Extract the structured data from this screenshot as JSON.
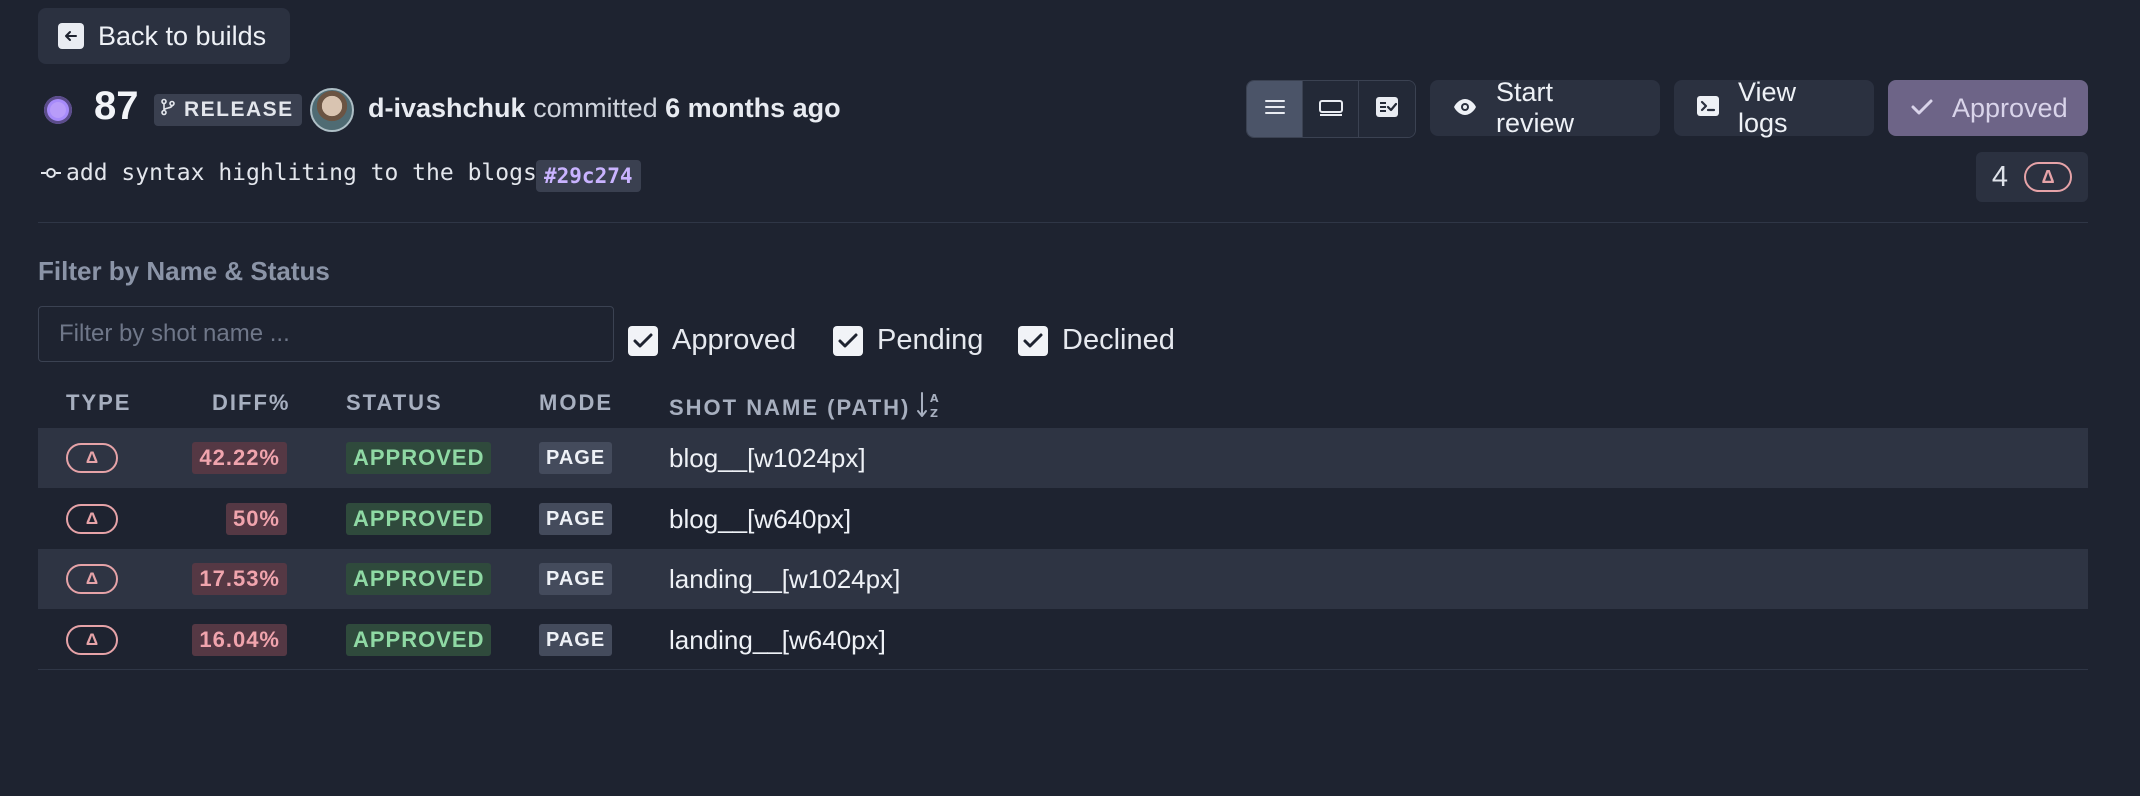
{
  "nav": {
    "back_label": "Back to builds"
  },
  "build": {
    "number": "87",
    "branch": "RELEASE",
    "author": "d-ivashchuk",
    "committed_text": "committed",
    "when": "6 months ago",
    "commit_message": "add syntax highliting to the blogs",
    "commit_hash": "#29c274",
    "changed_count": "4",
    "delta_symbol": "Δ",
    "status_color": "#a78bfa"
  },
  "toolbar": {
    "view_modes": [
      {
        "icon": "list-icon",
        "active": true
      },
      {
        "icon": "single-view-icon",
        "active": false
      },
      {
        "icon": "checklist-icon",
        "active": false
      }
    ],
    "start_review_label": "Start review",
    "view_logs_label": "View logs",
    "approved_label": "Approved"
  },
  "filter": {
    "title": "Filter by Name & Status",
    "placeholder": "Filter by shot name ...",
    "value": "",
    "statuses": [
      {
        "label": "Approved",
        "checked": true
      },
      {
        "label": "Pending",
        "checked": true
      },
      {
        "label": "Declined",
        "checked": true
      }
    ]
  },
  "table": {
    "headers": {
      "type": "TYPE",
      "diff": "DIFF%",
      "status": "STATUS",
      "mode": "MODE",
      "shot_name": "SHOT NAME (PATH)"
    },
    "sort_icon": "sort-alpha-down-icon",
    "rows": [
      {
        "type": "Δ",
        "diff": "42.22%",
        "status": "APPROVED",
        "mode": "PAGE",
        "name": "blog__[w1024px]"
      },
      {
        "type": "Δ",
        "diff": "50%",
        "status": "APPROVED",
        "mode": "PAGE",
        "name": "blog__[w640px]"
      },
      {
        "type": "Δ",
        "diff": "17.53%",
        "status": "APPROVED",
        "mode": "PAGE",
        "name": "landing__[w1024px]"
      },
      {
        "type": "Δ",
        "diff": "16.04%",
        "status": "APPROVED",
        "mode": "PAGE",
        "name": "landing__[w640px]"
      }
    ]
  },
  "colors": {
    "background": "#1e2330",
    "accent_purple": "#a78bfa",
    "approved_green": "#8fd9a4",
    "diff_red": "#f0a4ad"
  }
}
